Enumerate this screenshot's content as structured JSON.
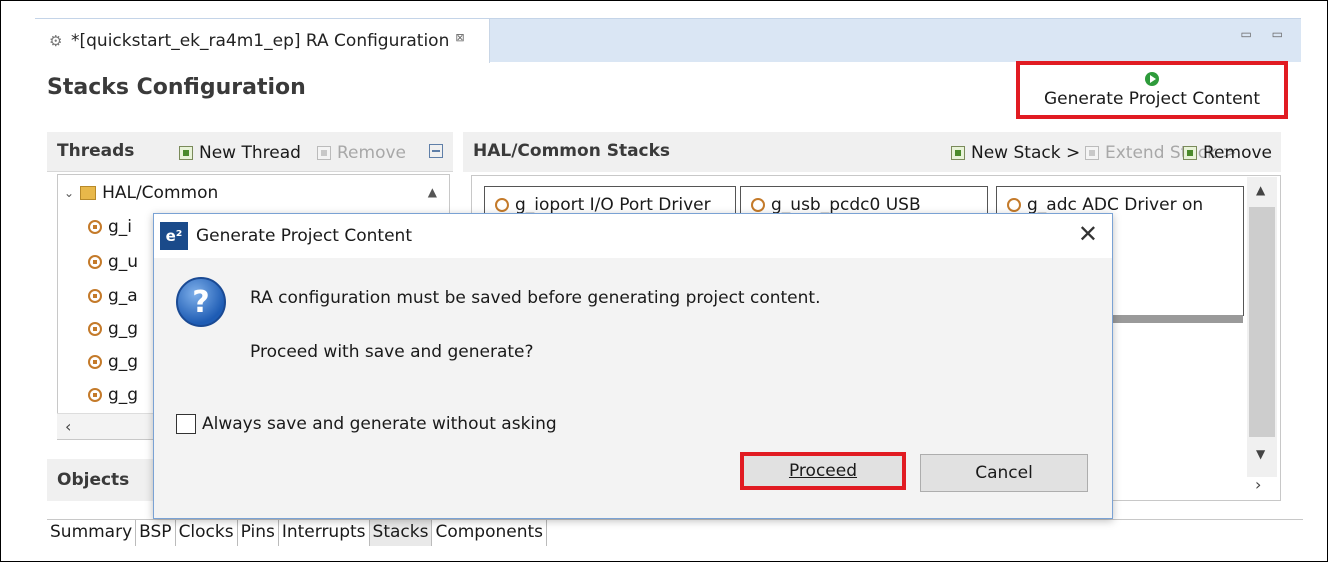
{
  "editor": {
    "tab_title": "*[quickstart_ek_ra4m1_ep] RA Configuration",
    "tab_close": "⊠",
    "window_controls": "▭ ▭"
  },
  "page": {
    "title": "Stacks Configuration",
    "generate_button": "Generate Project Content"
  },
  "threads": {
    "header": "Threads",
    "new_thread": "New Thread",
    "remove": "Remove",
    "tree_root": "HAL/Common",
    "tree_items": [
      "g_i",
      "g_u",
      "g_a",
      "g_g",
      "g_g",
      "g_g"
    ]
  },
  "objects": {
    "header": "Objects"
  },
  "stacks": {
    "header": "HAL/Common Stacks",
    "new_stack": "New Stack >",
    "extend_stack": "Extend Stack >",
    "remove": "Remove",
    "boxes": [
      "g_ioport I/O Port Driver",
      "g_usb_pcdc0 USB",
      "g_adc ADC Driver on"
    ]
  },
  "bottom_tabs": [
    "Summary",
    "BSP",
    "Clocks",
    "Pins",
    "Interrupts",
    "Stacks",
    "Components"
  ],
  "dialog": {
    "logo": "e²",
    "title": "Generate Project Content",
    "message": "RA configuration must be saved before generating project content.",
    "question": "Proceed with save and generate?",
    "checkbox_label": "Always save and generate without asking",
    "proceed": "Proceed",
    "cancel": "Cancel"
  },
  "colors": {
    "highlight": "#e11b22",
    "tab_bar": "#dae6f4",
    "dialog_border": "#7aa2d4"
  }
}
